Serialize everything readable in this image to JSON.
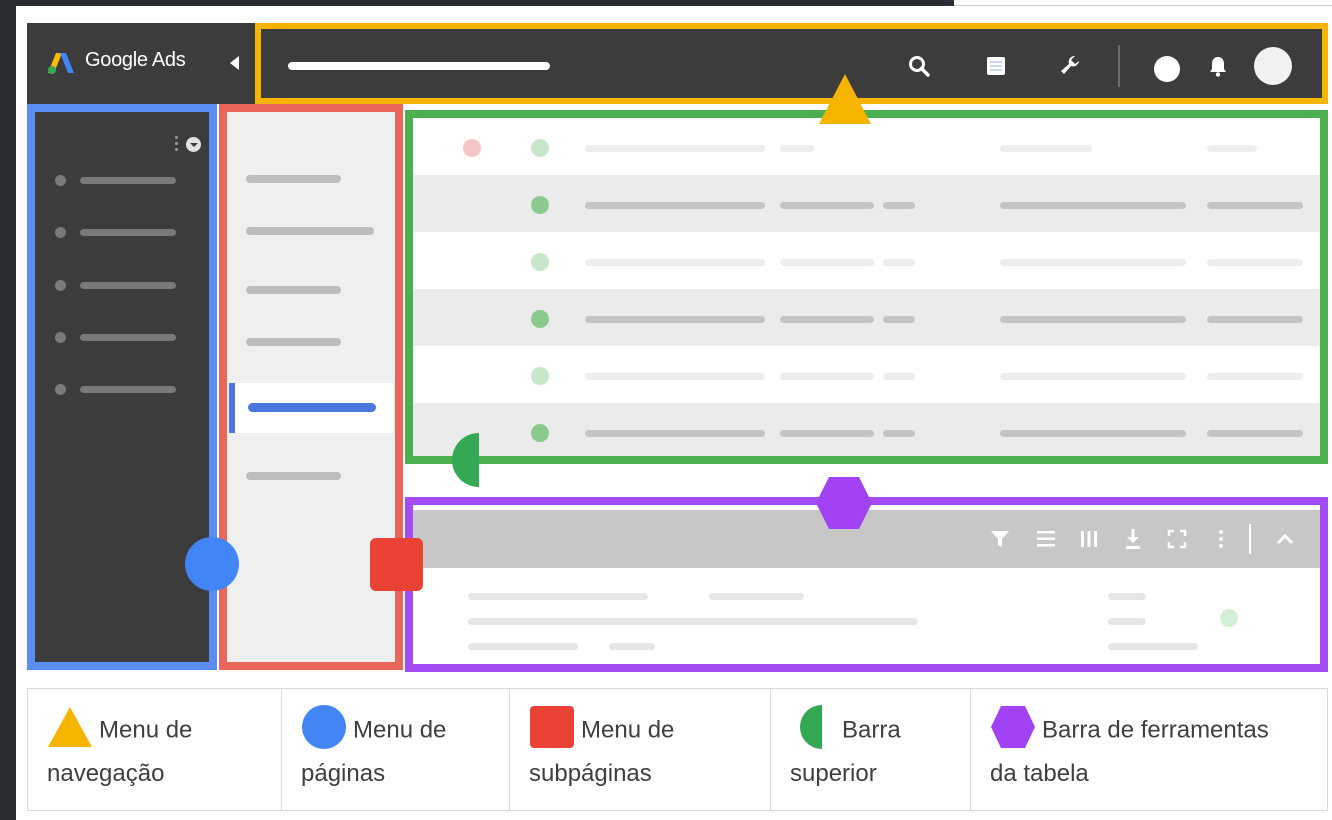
{
  "brand": {
    "name": "Google Ads"
  },
  "legend": [
    {
      "shape": "triangle",
      "color": "#f4b400",
      "line1": "Menu de",
      "line2": "navegação"
    },
    {
      "shape": "circle",
      "color": "#4285f4",
      "line1": "Menu de",
      "line2": "páginas"
    },
    {
      "shape": "square",
      "color": "#ea4335",
      "line1": "Menu de",
      "line2": "subpáginas"
    },
    {
      "shape": "half-circle",
      "color": "#34a853",
      "line1": "Barra",
      "line2": "superior"
    },
    {
      "shape": "hexagon",
      "color": "#a142f4",
      "line1": "Barra de ferramentas",
      "line2": "da tabela"
    }
  ],
  "colors": {
    "yellow": "#f4b400",
    "blue": "#4285f4",
    "red": "#ea4335",
    "green": "#34a853",
    "purple": "#a142f4"
  },
  "icons": {
    "topbar": [
      "search-icon",
      "reports-icon",
      "tools-icon",
      "help-icon",
      "bell-icon",
      "avatar"
    ],
    "table_toolbar": [
      "filter-icon",
      "segment-icon",
      "columns-icon",
      "download-icon",
      "expand-icon",
      "more-vert-icon",
      "chevron-up-icon"
    ]
  }
}
